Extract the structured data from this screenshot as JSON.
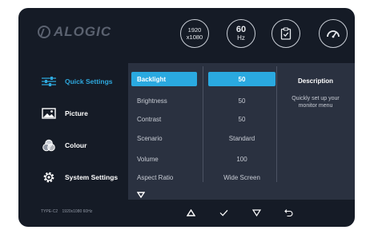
{
  "brand": {
    "logo_text": "ALOGIC"
  },
  "header": {
    "resolution_line1": "1920",
    "resolution_line2": "x1080",
    "refresh_value": "60",
    "refresh_unit": "Hz"
  },
  "nav": [
    {
      "label": "Quick Settings",
      "icon": "sliders-icon",
      "active": true
    },
    {
      "label": "Picture",
      "icon": "image-icon",
      "active": false
    },
    {
      "label": "Colour",
      "icon": "color-circles-icon",
      "active": false
    },
    {
      "label": "System Settings",
      "icon": "gear-icon",
      "active": false
    }
  ],
  "settings": [
    {
      "label": "Backlight",
      "value": "50",
      "selected": true
    },
    {
      "label": "Brightness",
      "value": "50",
      "selected": false
    },
    {
      "label": "Contrast",
      "value": "50",
      "selected": false
    },
    {
      "label": "Scenario",
      "value": "Standard",
      "selected": false
    },
    {
      "label": "Volume",
      "value": "100",
      "selected": false
    },
    {
      "label": "Aspect Ratio",
      "value": "Wide Screen",
      "selected": false
    }
  ],
  "description": {
    "title": "Description",
    "text": "Quickly set up your monitor menu"
  },
  "footer": {
    "port": "TYPE-C2",
    "signal": "1920x1080 60Hz"
  },
  "buttons": [
    "up-icon",
    "confirm-icon",
    "down-icon",
    "back-icon"
  ],
  "colors": {
    "accent": "#2aa9e0",
    "background": "#151b26",
    "panel": "#2a3140"
  }
}
